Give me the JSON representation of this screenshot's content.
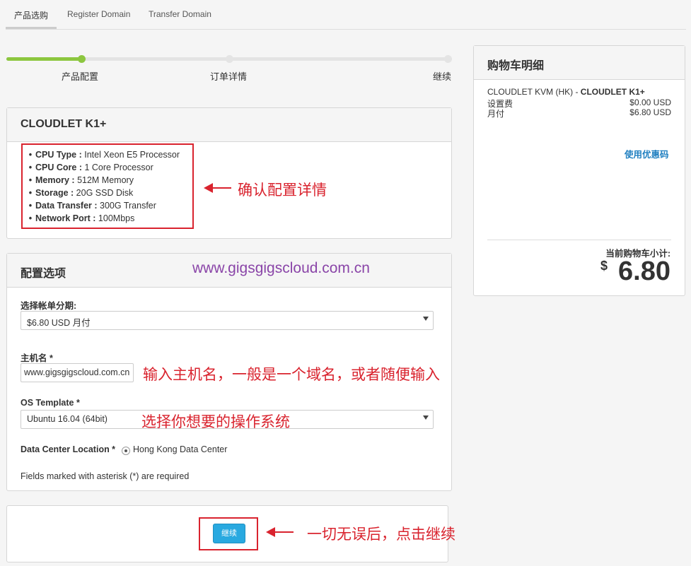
{
  "tabs": [
    "产品选购",
    "Register Domain",
    "Transfer Domain"
  ],
  "steps": {
    "progress": 0.17,
    "labels": [
      "产品配置",
      "订单详情",
      "继续"
    ]
  },
  "product": {
    "title": "CLOUDLET K1+",
    "features": [
      {
        "name": "CPU Type :",
        "value": "Intel Xeon E5 Processor"
      },
      {
        "name": "CPU Core :",
        "value": "1 Core Processor"
      },
      {
        "name": "Memory :",
        "value": "512M Memory"
      },
      {
        "name": "Storage :",
        "value": "20G SSD Disk"
      },
      {
        "name": "Data Transfer :",
        "value": "300G Transfer"
      },
      {
        "name": "Network Port :",
        "value": "100Mbps"
      }
    ]
  },
  "config": {
    "title": "配置选项",
    "billing_label": "选择帐单分期:",
    "billing_value": "$6.80 USD 月付",
    "hostname_label": "主机名 *",
    "hostname_value": "www.gigsgigscloud.com.cn",
    "os_label": "OS Template *",
    "os_value": "Ubuntu 16.04 (64bit)",
    "dc_label": "Data Center Location *",
    "dc_value": "Hong Kong Data Center",
    "required_note": "Fields marked with asterisk (*) are required"
  },
  "continue_button": "继续",
  "watermark": "www.gigsgigscloud.com.cn",
  "annotations": {
    "confirm": "确认配置详情",
    "hostname": "输入主机名，一般是一个域名，或者随便输入",
    "os": "选择你想要的操作系统",
    "continue": "一切无误后，点击继续"
  },
  "cart": {
    "title": "购物车明细",
    "product_prefix": "CLOUDLET KVM (HK) - ",
    "product_name": "CLOUDLET K1+",
    "setup_label": "设置费",
    "setup_value": "$0.00 USD",
    "monthly_label": "月付",
    "monthly_value": "$6.80 USD",
    "coupon": "使用优惠码",
    "subtotal_label": "当前购物车小计:",
    "currency": "$",
    "total": "6.80"
  },
  "colors": {
    "accent": "#8cc63f",
    "button": "#29a9e0",
    "annotation": "#d9232e",
    "watermark": "#8a45a8",
    "link": "#1f7fc0"
  }
}
